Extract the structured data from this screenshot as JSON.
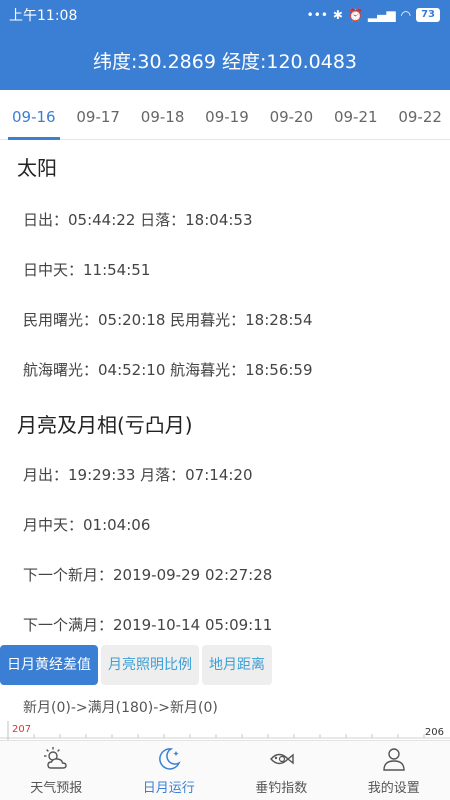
{
  "status_bar": {
    "time": "上午11:08",
    "battery": "73"
  },
  "header": {
    "coords": "纬度:30.2869 经度:120.0483"
  },
  "date_tabs": [
    "09-16",
    "09-17",
    "09-18",
    "09-19",
    "09-20",
    "09-21",
    "09-22"
  ],
  "sun": {
    "title": "太阳",
    "rise_set": "日出：05:44:22 日落：18:04:53",
    "transit": "日中天：11:54:51",
    "civil": "民用曙光：05:20:18 民用暮光：18:28:54",
    "nautical": "航海曙光：04:52:10 航海暮光：18:56:59"
  },
  "moon": {
    "title": "月亮及月相(亏凸月)",
    "rise_set": "月出：19:29:33 月落：07:14:20",
    "transit": "月中天：01:04:06",
    "next_new": "下一个新月：2019-09-29 02:27:28",
    "next_full": "下一个满月：2019-10-14 05:09:11"
  },
  "chart_tabs": [
    "日月黄经差值",
    "月亮照明比例",
    "地月距离"
  ],
  "chart": {
    "caption": "新月(0)->满月(180)->新月(0)",
    "ymax_label": "207",
    "right_label": "206"
  },
  "chart_data": {
    "type": "line",
    "title": "新月(0)->满月(180)->新月(0)",
    "ytick_labels": [
      "207"
    ],
    "annotations": [
      "206"
    ]
  },
  "bottom_nav": [
    {
      "label": "天气预报",
      "icon": "weather-icon"
    },
    {
      "label": "日月运行",
      "icon": "moon-icon"
    },
    {
      "label": "垂钓指数",
      "icon": "fish-icon"
    },
    {
      "label": "我的设置",
      "icon": "user-icon"
    }
  ]
}
